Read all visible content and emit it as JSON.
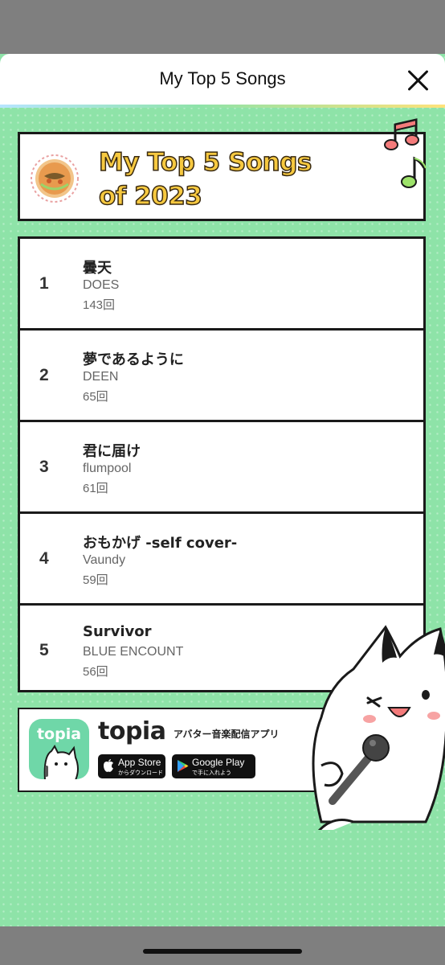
{
  "header": {
    "title": "My Top 5 Songs"
  },
  "card": {
    "title_line1": "My Top 5 Songs",
    "title_line2": "of 2023"
  },
  "songs": [
    {
      "rank": "1",
      "title": "曇天",
      "artist": "DOES",
      "count": "143回"
    },
    {
      "rank": "2",
      "title": "夢であるように",
      "artist": "DEEN",
      "count": "65回"
    },
    {
      "rank": "3",
      "title": "君に届け",
      "artist": "flumpool",
      "count": "61回"
    },
    {
      "rank": "4",
      "title": "おもかげ -self cover-",
      "artist": "Vaundy",
      "count": "59回"
    },
    {
      "rank": "5",
      "title": "Survivor",
      "artist": "BLUE ENCOUNT",
      "count": "56回"
    }
  ],
  "promo": {
    "icon_label": "topia",
    "brand": "topia",
    "tagline": "アバター音楽配信アプリ",
    "app_store": {
      "main": "App Store",
      "sub": "からダウンロード"
    },
    "google_play": {
      "main": "Google Play",
      "sub": "で手に入れよう"
    }
  },
  "colors": {
    "background": "#8ee3a8",
    "title_yellow": "#f7c940",
    "border": "#1a1a1a"
  },
  "icons": [
    "close-icon",
    "music-note-icon",
    "apple-icon",
    "google-play-icon"
  ]
}
